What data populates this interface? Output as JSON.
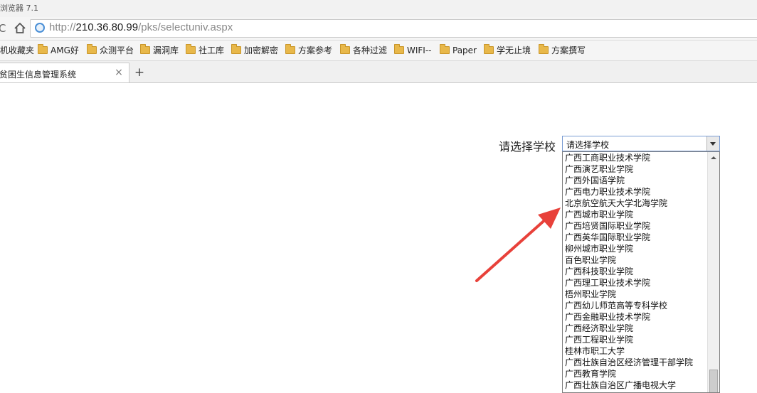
{
  "browser": {
    "title": "浏览器 7.1",
    "url_protocol": "http://",
    "url_host": "210.36.80.99",
    "url_path": "/pks/selectuniv.aspx"
  },
  "bookmarks": [
    {
      "label": "机收藏夹",
      "icon": "none"
    },
    {
      "label": "AMG好",
      "icon": "folder-icon"
    },
    {
      "label": "众测平台",
      "icon": "folder-icon"
    },
    {
      "label": "漏洞库",
      "icon": "folder-icon"
    },
    {
      "label": "社工库",
      "icon": "folder-icon"
    },
    {
      "label": "加密解密",
      "icon": "folder-icon"
    },
    {
      "label": "方案参考",
      "icon": "folder-icon"
    },
    {
      "label": "各种过滤",
      "icon": "folder-icon"
    },
    {
      "label": "WIFI--",
      "icon": "folder-icon"
    },
    {
      "label": "Paper",
      "icon": "folder-icon"
    },
    {
      "label": "学无止境",
      "icon": "folder-icon"
    },
    {
      "label": "方案撰写",
      "icon": "folder-icon"
    }
  ],
  "tab": {
    "label": "贫困生信息管理系统",
    "close": "×",
    "new_tab": "+"
  },
  "form": {
    "label": "请选择学校",
    "selected": "请选择学校"
  },
  "dropdown": {
    "options": [
      "广西工商职业技术学院",
      "广西演艺职业学院",
      "广西外国语学院",
      "广西电力职业技术学院",
      "北京航空航天大学北海学院",
      "广西城市职业学院",
      "广西培贤国际职业学院",
      "广西英华国际职业学院",
      "柳州城市职业学院",
      "百色职业学院",
      "广西科技职业学院",
      "广西理工职业技术学院",
      "梧州职业学院",
      "广西幼儿师范高等专科学校",
      "广西金融职业技术学院",
      "广西经济职业学院",
      "广西工程职业学院",
      "桂林市职工大学",
      "广西壮族自治区经济管理干部学院",
      "广西教育学院",
      "广西壮族自治区广播电视大学"
    ]
  },
  "colors": {
    "annotation_arrow": "#e8413a",
    "select_border": "#7a9cd3",
    "folder": "#e8b84a"
  }
}
